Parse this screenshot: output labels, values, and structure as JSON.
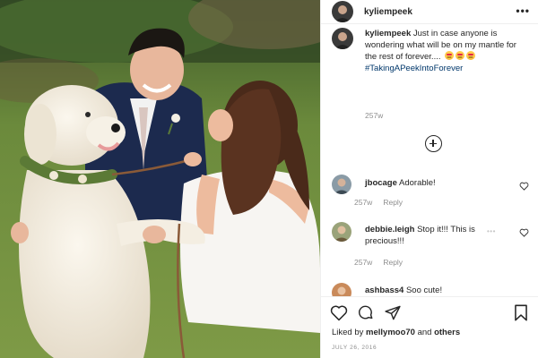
{
  "post": {
    "author": "kyliempeek",
    "caption_text": "Just in case anyone is wondering what will be on my mantle for the rest of forever....",
    "hashtag": "#TakingAPeekIntoForever",
    "caption_time": "257w",
    "date": "JULY 26, 2016"
  },
  "comments": [
    {
      "username": "jbocage",
      "text": "Adorable!",
      "time": "257w",
      "reply_label": "Reply"
    },
    {
      "username": "debbie.leigh",
      "text": "Stop it!!! This is precious!!!",
      "time": "257w",
      "reply_label": "Reply"
    },
    {
      "username": "ashbass4",
      "text": "Soo cute!",
      "time": "",
      "reply_label": ""
    }
  ],
  "likes": {
    "prefix": "Liked by",
    "user": "mellymoo70",
    "connector": "and",
    "others": "others"
  },
  "icons": {
    "more": "more-options-icon",
    "load_more": "plus-circle-icon",
    "like": "heart-icon",
    "comment": "comment-icon",
    "share": "paper-plane-icon",
    "save": "bookmark-icon"
  },
  "colors": {
    "text": "#262626",
    "muted": "#8e8e8e",
    "hashtag": "#00376b",
    "divider": "#efefef"
  }
}
